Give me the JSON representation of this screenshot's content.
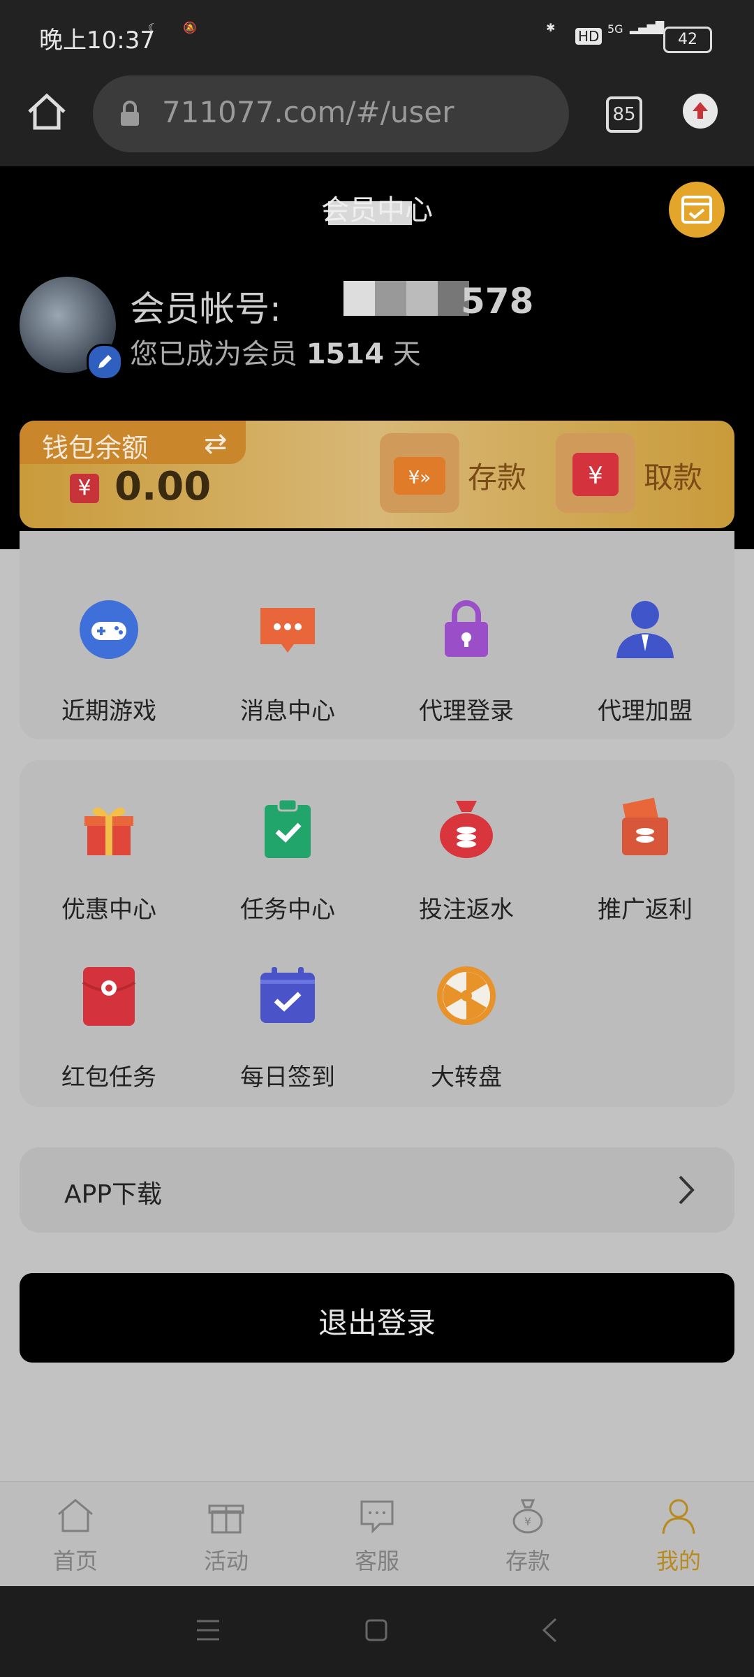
{
  "status_bar": {
    "time": "晚上10:37",
    "battery": "42",
    "network": "5G",
    "hd": "HD"
  },
  "browser": {
    "url": "711077.com/#/user",
    "tab_count": "85"
  },
  "header": {
    "title": "会员中心",
    "account_label": "会员帐号:",
    "account_suffix": "578",
    "member_prefix": "您已成为会员",
    "member_days": "1514",
    "member_suffix": "天"
  },
  "wallet": {
    "label": "钱包余额",
    "currency": "¥",
    "balance": "0.00",
    "deposit_label": "存款",
    "withdraw_label": "取款"
  },
  "grid1": [
    {
      "label": "近期游戏",
      "icon": "gamepad-icon"
    },
    {
      "label": "消息中心",
      "icon": "message-icon"
    },
    {
      "label": "代理登录",
      "icon": "lock-icon"
    },
    {
      "label": "代理加盟",
      "icon": "agent-icon"
    }
  ],
  "grid2": [
    {
      "label": "优惠中心",
      "icon": "gift-icon"
    },
    {
      "label": "任务中心",
      "icon": "clipboard-check-icon"
    },
    {
      "label": "投注返水",
      "icon": "money-bag-icon"
    },
    {
      "label": "推广返利",
      "icon": "rebate-icon"
    },
    {
      "label": "红包任务",
      "icon": "red-envelope-icon"
    },
    {
      "label": "每日签到",
      "icon": "calendar-check-icon"
    },
    {
      "label": "大转盘",
      "icon": "wheel-icon"
    }
  ],
  "app_download": {
    "label": "APP下载"
  },
  "logout": {
    "label": "退出登录"
  },
  "bottom_nav": [
    {
      "label": "首页",
      "icon": "home-icon"
    },
    {
      "label": "活动",
      "icon": "gift-outline-icon"
    },
    {
      "label": "客服",
      "icon": "chat-icon"
    },
    {
      "label": "存款",
      "icon": "money-bag-outline-icon"
    },
    {
      "label": "我的",
      "icon": "user-icon"
    }
  ],
  "colors": {
    "accent": "#b88a1e",
    "header_bg": "#000000",
    "wallet_gold": "#d8b877"
  }
}
